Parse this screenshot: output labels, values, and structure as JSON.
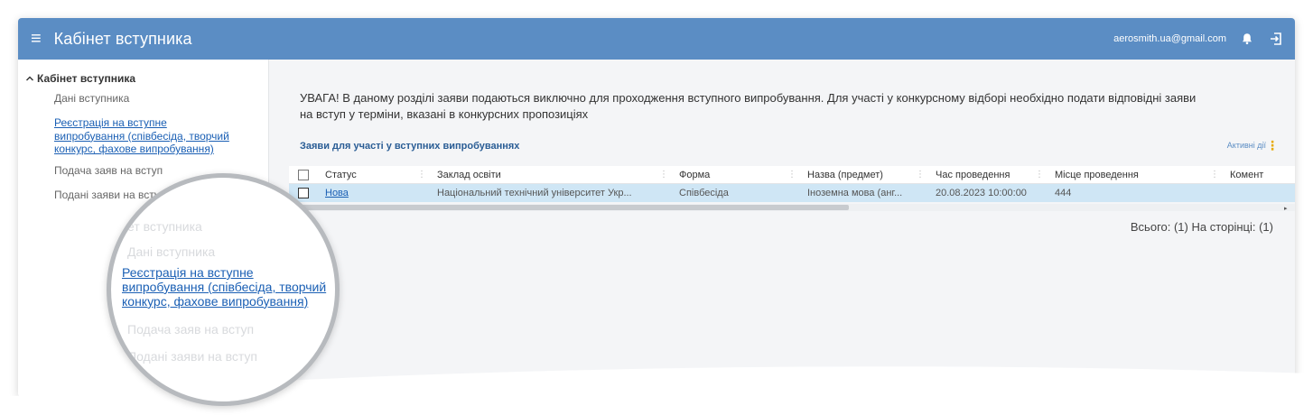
{
  "header": {
    "title": "Кабінет вступника",
    "email": "aerosmith.ua@gmail.com",
    "menu_icon": "≡",
    "icons": [
      "menu-icon",
      "bell-icon",
      "logout-icon"
    ]
  },
  "sidebar": {
    "heading": "Кабінет вступника",
    "items": [
      {
        "label": "Дані вступника"
      },
      {
        "label": "Реєстрація на вступне",
        "label2": "випробування (співбесіда, творчий",
        "label3": "конкурс, фахове випробування)"
      },
      {
        "label": "Подача заяв на вступ"
      },
      {
        "label": "Подані заяви на вступ"
      }
    ]
  },
  "main": {
    "notice_line1": "УВАГА! В даному розділі заяви подаються виключно для проходження вступного випробування. Для участі у конкурсному відборі необхідно подати відповідні заяви",
    "notice_line2": "на вступ у терміни, вказані в конкурсних пропозиціях",
    "section_title": "Заяви для участі у вступних випробуваннях",
    "active_actions": "Активні дії",
    "kebab": "⋮",
    "table": {
      "headers": [
        "Статус",
        "Заклад освіти",
        "Форма",
        "Назва (предмет)",
        "Час проведення",
        "Місце проведення",
        "Комент"
      ],
      "rows": [
        [
          "Нова",
          "Національний технічний університет Укр...",
          "Співбесіда",
          "Іноземна мова (анг...",
          "20.08.2023 10:00:00",
          "444",
          ""
        ]
      ]
    },
    "total": "Всього: (1) На сторінці: (1)"
  },
  "magnifier": {
    "faded_items": [
      "ет вступника",
      "Дані вступника",
      "Подача заяв на вступ",
      "Подані заяви на вступ"
    ],
    "active_line1": "Реєстрація на вступне",
    "active_line2": "випробування (співбесіда, творчий",
    "active_line3": "конкурс, фахове випробування)"
  },
  "colors": {
    "topbar": "#5b8dc4",
    "link": "#1a5fb4",
    "selected_row": "#cfe6f5",
    "kebab": "#e7a900"
  }
}
